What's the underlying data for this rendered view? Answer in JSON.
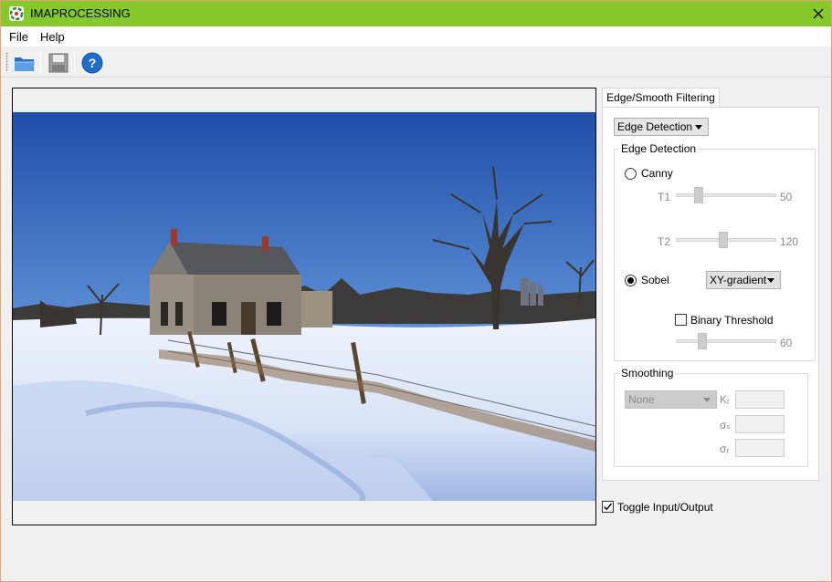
{
  "app": {
    "title": "IMAPROCESSING"
  },
  "menu": {
    "file": "File",
    "help": "Help"
  },
  "toolbar": {
    "icons": [
      "open-folder-icon",
      "save-disk-icon",
      "help-icon"
    ]
  },
  "tab": {
    "label": "Edge/Smooth Filtering"
  },
  "mode_combo": {
    "value": "Edge Detection"
  },
  "edge_group": {
    "title": "Edge Detection",
    "canny": {
      "label": "Canny",
      "selected": false
    },
    "t1": {
      "label": "T1",
      "value": "50"
    },
    "t2": {
      "label": "T2",
      "value": "120"
    },
    "sobel": {
      "label": "Sobel",
      "selected": true
    },
    "gradient_combo": {
      "value": "XY-gradient"
    },
    "binary_threshold": {
      "label": "Binary Threshold",
      "checked": false,
      "value": "60"
    }
  },
  "smoothing_group": {
    "title": "Smoothing",
    "filter_combo": {
      "value": "None"
    },
    "kr_label": "Kᵣ",
    "sigma_s_label": "σₛ",
    "sigma_r_label": "σᵣ"
  },
  "toggle": {
    "label": "Toggle Input/Output",
    "checked": true
  },
  "colors": {
    "titlebar": "#86c92a",
    "sky_top": "#1f4fa8",
    "sky_bottom": "#8fb4e6",
    "snow": "#e8eefa"
  }
}
